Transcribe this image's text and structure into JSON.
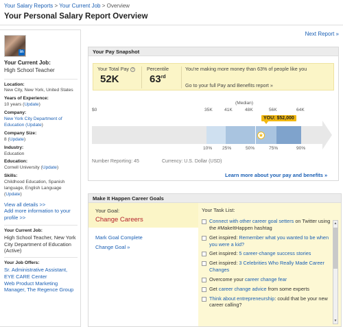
{
  "breadcrumb": {
    "item1": "Your Salary Reports",
    "sep1": ">",
    "item2": "Your Current Job",
    "sep2": ">",
    "item3": "Overview"
  },
  "page_title": "Your Personal Salary Report Overview",
  "next_report": "Next Report »",
  "sidebar": {
    "current_job_heading": "Your Current Job:",
    "current_job_value": "High School Teacher",
    "location_label": "Location:",
    "location_value": "New City, New York, United States",
    "experience_label": "Years of Experience:",
    "experience_value": "10 years (",
    "experience_update": "Update",
    "company_label": "Company:",
    "company_value": "New York City Department of Education (",
    "company_update": "Update",
    "size_label": "Company Size:",
    "size_value": "8 (",
    "size_update": "Update",
    "industry_label": "Industry:",
    "industry_value": "Education",
    "education_label": "Education:",
    "education_value": "Cornell University (",
    "education_update": "Update",
    "skills_label": "Skills:",
    "skills_value": "Childhood Education, Spanish language, English Language (",
    "skills_update": "Update",
    "view_all": "View all details >>",
    "add_more": "Add more information to your profile >>",
    "current_job2_label": "Your Current Job:",
    "current_job2_value": "High School Teacher, New York City Department of Education (Active)",
    "offers_label": "Your Job Offers:",
    "offer1": "Sr. Administrative Assistant, EYE CARE Center",
    "offer2": "Web Product Marketing Manager, The Regence Group",
    "close_paren": ")",
    "linkedin_badge": "in"
  },
  "snapshot": {
    "header": "Your Pay Snapshot",
    "total_pay_label": "Your Total Pay",
    "help_icon": "?",
    "total_pay_value": "52K",
    "percentile_label": "Percentile",
    "percentile_value": "63",
    "percentile_suffix": "rd",
    "message": "You're making more money than 63% of people like you",
    "benefits_link": "Go to your full Pay and Benefits report »",
    "median_label": "(Median)",
    "zero_tick": "$0",
    "value_ticks": [
      "35K",
      "41K",
      "48K",
      "56K",
      "64K"
    ],
    "percentile_ticks": [
      "10%",
      "25%",
      "50%",
      "75%",
      "90%"
    ],
    "you_label": "YOU: $52,000",
    "your_percentile": 63,
    "number_reporting": "Number Reporting: 45",
    "currency": "Currency: U.S. Dollar (USD)",
    "learn_more": "Learn more about your pay and benefits »",
    "colors": {
      "band_outer": "#cfe0f0",
      "band_mid": "#a9c4e0",
      "band_inner": "#7fa3cc",
      "you": "#f2b80f"
    }
  },
  "goals": {
    "header": "Make It Happen Career Goals",
    "your_goal_label": "Your Goal:",
    "goal_title": "Change Careers",
    "mark_complete": "Mark Goal Complete",
    "change_goal": "Change Goal »",
    "task_list_label": "Your Task List:",
    "tasks": [
      {
        "link": "Connect with other career goal setters",
        "rest": " on Twitter using the #MakeItHappen hashtag",
        "prefix": ""
      },
      {
        "prefix": "Get inspired: ",
        "link": "Remember what you wanted to be when you were a kid?",
        "rest": ""
      },
      {
        "prefix": "Get inspired: ",
        "link": "5 career-change success stories",
        "rest": ""
      },
      {
        "prefix": "Get inspired: ",
        "link": "3 Celebrities Who Really Made Career Changes",
        "rest": ""
      },
      {
        "prefix": "Overcome your ",
        "link": "career change fear",
        "rest": ""
      },
      {
        "prefix": "Get ",
        "link": "career change advice",
        "rest": " from some experts"
      },
      {
        "prefix": "",
        "link": "Think about entrepreneurship",
        "rest": ": could that be your new career calling?"
      }
    ]
  }
}
